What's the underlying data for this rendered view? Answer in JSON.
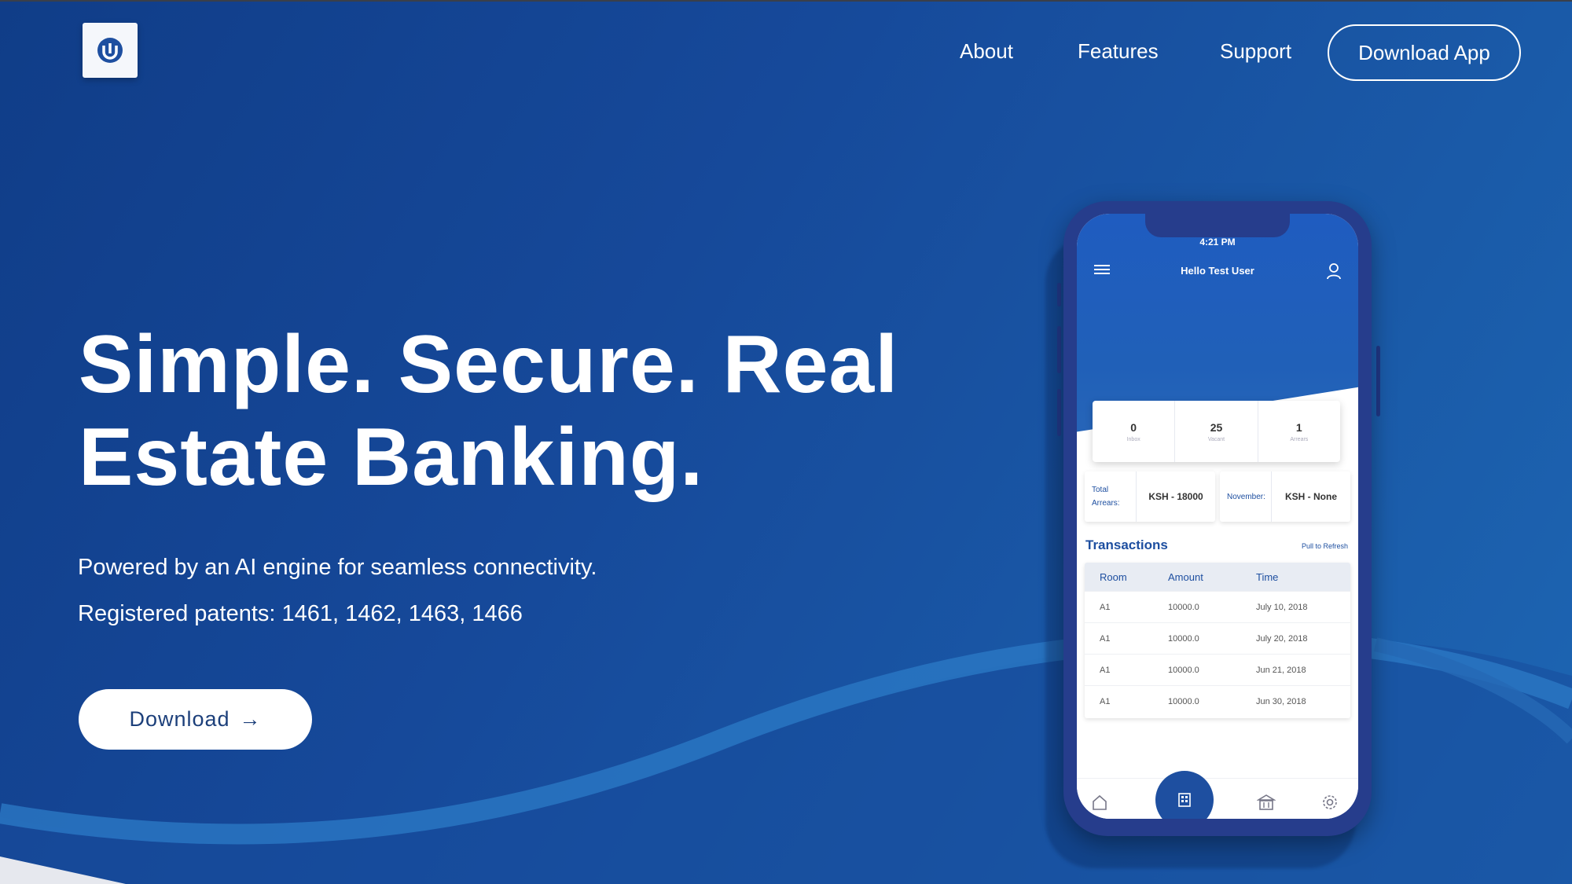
{
  "nav": {
    "about": "About",
    "features": "Features",
    "support": "Support",
    "download_app": "Download App"
  },
  "hero": {
    "title_line1": "Simple. Secure. Real",
    "title_line2": "Estate Banking.",
    "subtitle": "Powered by an AI engine for seamless connectivity.",
    "patents": "Registered patents: 1461, 1462, 1463, 1466",
    "cta_label": "Download",
    "cta_arrow": "→"
  },
  "phone": {
    "time": "4:21 PM",
    "greeting": "Hello Test User",
    "stats": [
      {
        "value": "0",
        "label": "Inbox"
      },
      {
        "value": "25",
        "label": "Vacant"
      },
      {
        "value": "1",
        "label": "Arrears"
      }
    ],
    "cards": [
      {
        "label": "Total Arrears:",
        "value": "KSH - 18000"
      },
      {
        "label": "November:",
        "value": "KSH - None"
      }
    ],
    "transactions_title": "Transactions",
    "refresh_label": "Pull to Refresh",
    "table": {
      "columns": [
        "Room",
        "Amount",
        "Time"
      ],
      "rows": [
        [
          "A1",
          "10000.0",
          "July 10, 2018"
        ],
        [
          "A1",
          "10000.0",
          "July 20, 2018"
        ],
        [
          "A1",
          "10000.0",
          "Jun 21, 2018"
        ],
        [
          "A1",
          "10000.0",
          "Jun 30, 2018"
        ]
      ]
    },
    "tabs": [
      "home-icon",
      "building-icon",
      "bank-icon",
      "gear-icon"
    ]
  },
  "colors": {
    "background": "#16499a",
    "accent": "#1e4fa0",
    "text": "#ffffff"
  }
}
